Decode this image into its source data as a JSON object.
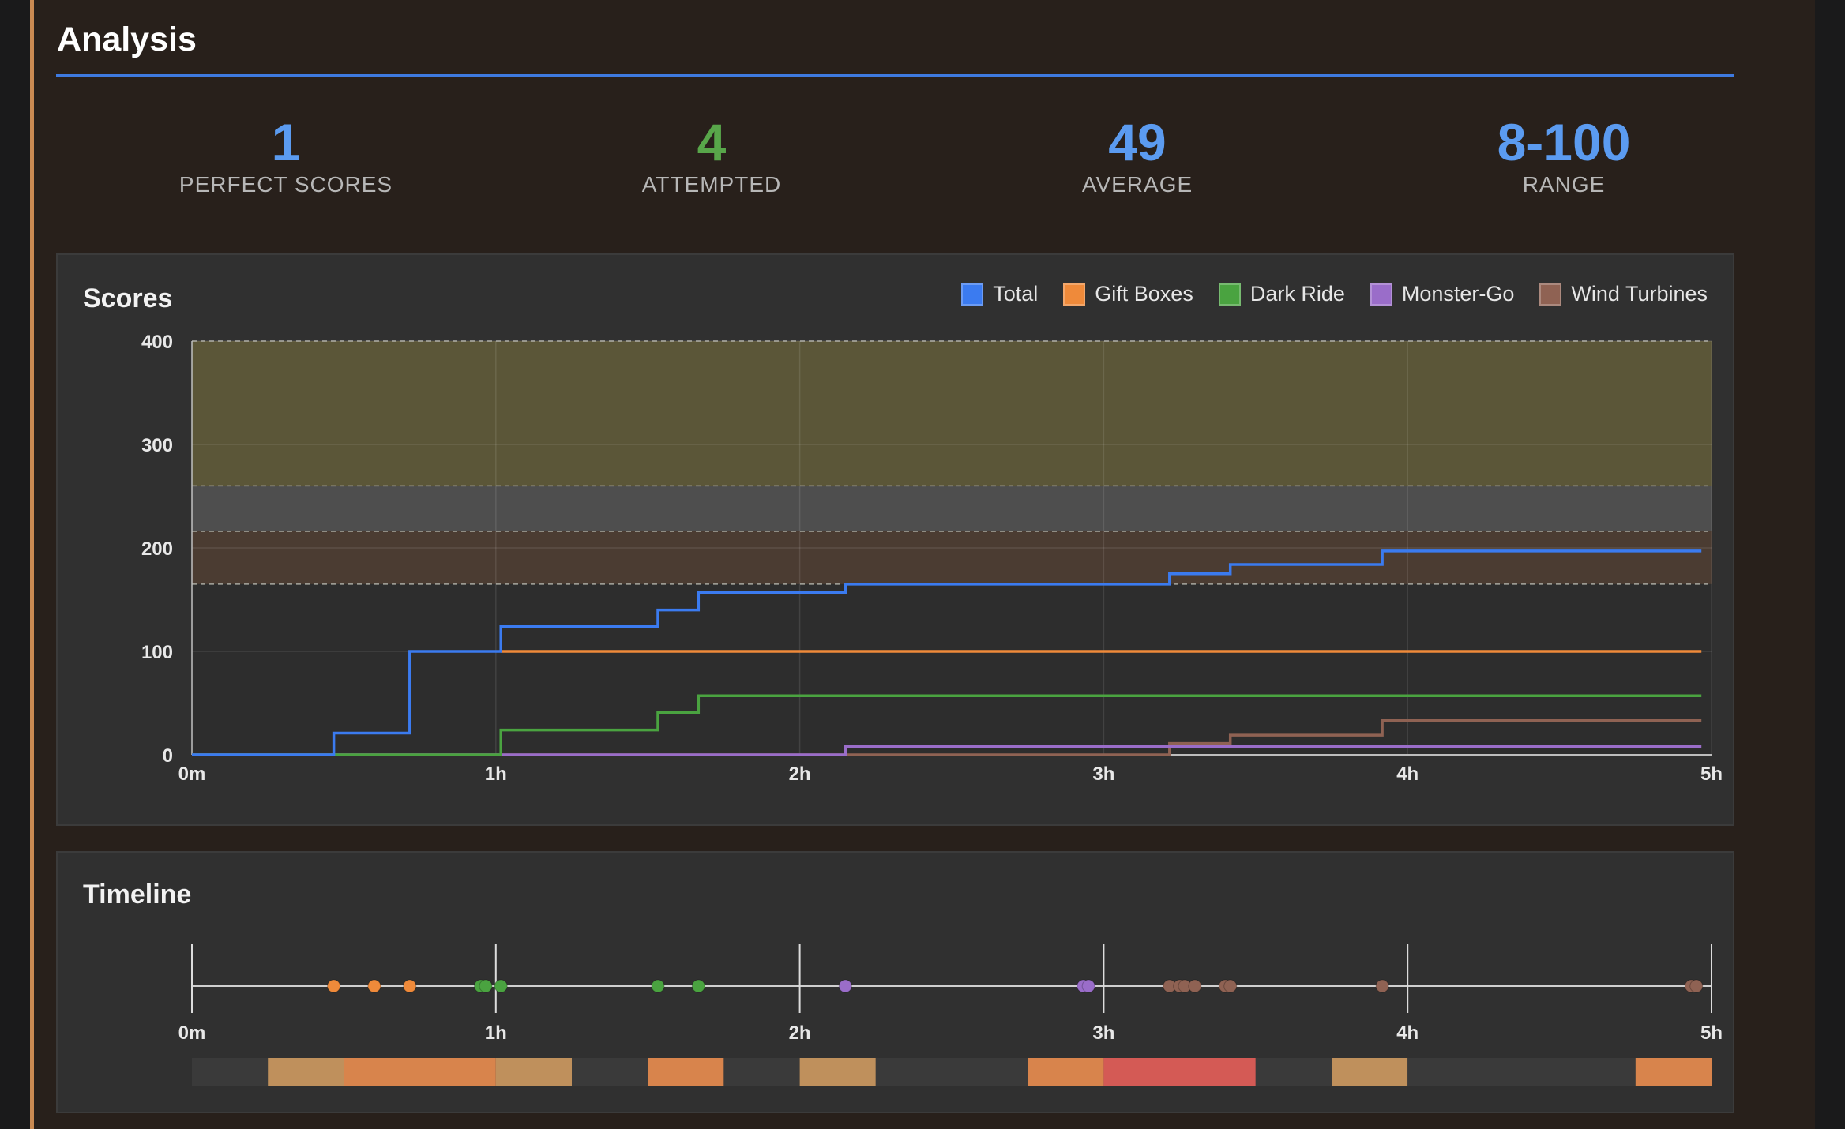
{
  "header": {
    "title": "Analysis"
  },
  "stats": [
    {
      "value": "1",
      "label": "PERFECT SCORES",
      "color": "#5b9bf0"
    },
    {
      "value": "4",
      "label": "ATTEMPTED",
      "color": "#58a64a"
    },
    {
      "value": "49",
      "label": "AVERAGE",
      "color": "#5b9bf0"
    },
    {
      "value": "8-100",
      "label": "RANGE",
      "color": "#5b9bf0"
    }
  ],
  "scores_card": {
    "title": "Scores"
  },
  "timeline_card": {
    "title": "Timeline"
  },
  "colors": {
    "accent_line": "#3e7ae0",
    "total": "#3b7bf0",
    "gift_boxes": "#ef8a3a",
    "dark_ride": "#4aa340",
    "monster_go": "#9a6dc9",
    "wind_turbines": "#8f6253"
  },
  "chart_data": {
    "type": "line",
    "title": "Scores",
    "xlabel": "",
    "ylabel": "",
    "xlim": [
      0,
      300
    ],
    "ylim": [
      0,
      400
    ],
    "x_unit": "minutes",
    "x_ticks": [
      {
        "v": 0,
        "label": "0m"
      },
      {
        "v": 60,
        "label": "1h"
      },
      {
        "v": 120,
        "label": "2h"
      },
      {
        "v": 180,
        "label": "3h"
      },
      {
        "v": 240,
        "label": "4h"
      },
      {
        "v": 300,
        "label": "5h"
      }
    ],
    "y_ticks": [
      0,
      100,
      200,
      300,
      400
    ],
    "grid": true,
    "legend_position": "top-right",
    "bands": [
      {
        "from": 260,
        "to": 400,
        "color": "#5b5638"
      },
      {
        "from": 216,
        "to": 260,
        "color": "#4e4e4e"
      },
      {
        "from": 165,
        "to": 216,
        "color": "#4b3c32"
      }
    ],
    "series": [
      {
        "name": "Total",
        "color": "#3b7bf0",
        "points": [
          [
            0,
            0
          ],
          [
            28,
            0
          ],
          [
            28,
            21
          ],
          [
            43,
            21
          ],
          [
            43,
            100
          ],
          [
            61,
            100
          ],
          [
            61,
            124
          ],
          [
            92,
            124
          ],
          [
            92,
            140
          ],
          [
            100,
            140
          ],
          [
            100,
            157
          ],
          [
            129,
            157
          ],
          [
            129,
            165
          ],
          [
            193,
            165
          ],
          [
            193,
            175
          ],
          [
            205,
            175
          ],
          [
            205,
            184
          ],
          [
            235,
            184
          ],
          [
            235,
            197
          ],
          [
            298,
            197
          ]
        ]
      },
      {
        "name": "Gift Boxes",
        "color": "#ef8a3a",
        "points": [
          [
            61,
            100
          ],
          [
            298,
            100
          ]
        ]
      },
      {
        "name": "Dark Ride",
        "color": "#4aa340",
        "points": [
          [
            0,
            0
          ],
          [
            61,
            0
          ],
          [
            61,
            24
          ],
          [
            92,
            24
          ],
          [
            92,
            41
          ],
          [
            100,
            41
          ],
          [
            100,
            57
          ],
          [
            298,
            57
          ]
        ]
      },
      {
        "name": "Monster-Go",
        "color": "#9a6dc9",
        "points": [
          [
            0,
            0
          ],
          [
            129,
            0
          ],
          [
            129,
            8
          ],
          [
            298,
            8
          ]
        ]
      },
      {
        "name": "Wind Turbines",
        "color": "#8f6253",
        "points": [
          [
            0,
            0
          ],
          [
            193,
            0
          ],
          [
            193,
            11
          ],
          [
            205,
            11
          ],
          [
            205,
            19
          ],
          [
            235,
            19
          ],
          [
            235,
            33
          ],
          [
            298,
            33
          ]
        ]
      }
    ]
  },
  "timeline_data": {
    "xlim": [
      0,
      300
    ],
    "x_ticks": [
      {
        "v": 0,
        "label": "0m"
      },
      {
        "v": 60,
        "label": "1h"
      },
      {
        "v": 120,
        "label": "2h"
      },
      {
        "v": 180,
        "label": "3h"
      },
      {
        "v": 240,
        "label": "4h"
      },
      {
        "v": 300,
        "label": "5h"
      }
    ],
    "events": [
      {
        "t": 28,
        "series": "gift_boxes"
      },
      {
        "t": 36,
        "series": "gift_boxes"
      },
      {
        "t": 43,
        "series": "gift_boxes"
      },
      {
        "t": 57,
        "series": "dark_ride"
      },
      {
        "t": 58,
        "series": "dark_ride"
      },
      {
        "t": 61,
        "series": "dark_ride"
      },
      {
        "t": 92,
        "series": "dark_ride"
      },
      {
        "t": 100,
        "series": "dark_ride"
      },
      {
        "t": 129,
        "series": "monster_go"
      },
      {
        "t": 176,
        "series": "monster_go"
      },
      {
        "t": 177,
        "series": "monster_go"
      },
      {
        "t": 193,
        "series": "wind_turbines"
      },
      {
        "t": 195,
        "series": "wind_turbines"
      },
      {
        "t": 196,
        "series": "wind_turbines"
      },
      {
        "t": 198,
        "series": "wind_turbines"
      },
      {
        "t": 204,
        "series": "wind_turbines"
      },
      {
        "t": 205,
        "series": "wind_turbines"
      },
      {
        "t": 235,
        "series": "wind_turbines"
      },
      {
        "t": 296,
        "series": "wind_turbines"
      },
      {
        "t": 297,
        "series": "wind_turbines"
      }
    ],
    "bar_segments": [
      {
        "from": 0,
        "to": 15,
        "color": "#3a3a3a"
      },
      {
        "from": 15,
        "to": 30,
        "color": "#bf905c"
      },
      {
        "from": 30,
        "to": 60,
        "color": "#d8844c"
      },
      {
        "from": 60,
        "to": 75,
        "color": "#bf905c"
      },
      {
        "from": 75,
        "to": 90,
        "color": "#3a3a3a"
      },
      {
        "from": 90,
        "to": 105,
        "color": "#d8844c"
      },
      {
        "from": 105,
        "to": 120,
        "color": "#3a3a3a"
      },
      {
        "from": 120,
        "to": 135,
        "color": "#bf905c"
      },
      {
        "from": 135,
        "to": 165,
        "color": "#3a3a3a"
      },
      {
        "from": 165,
        "to": 180,
        "color": "#d8844c"
      },
      {
        "from": 180,
        "to": 210,
        "color": "#d45a55"
      },
      {
        "from": 210,
        "to": 225,
        "color": "#3a3a3a"
      },
      {
        "from": 225,
        "to": 240,
        "color": "#bf905c"
      },
      {
        "from": 240,
        "to": 285,
        "color": "#3a3a3a"
      },
      {
        "from": 285,
        "to": 300,
        "color": "#d8844c"
      }
    ]
  }
}
